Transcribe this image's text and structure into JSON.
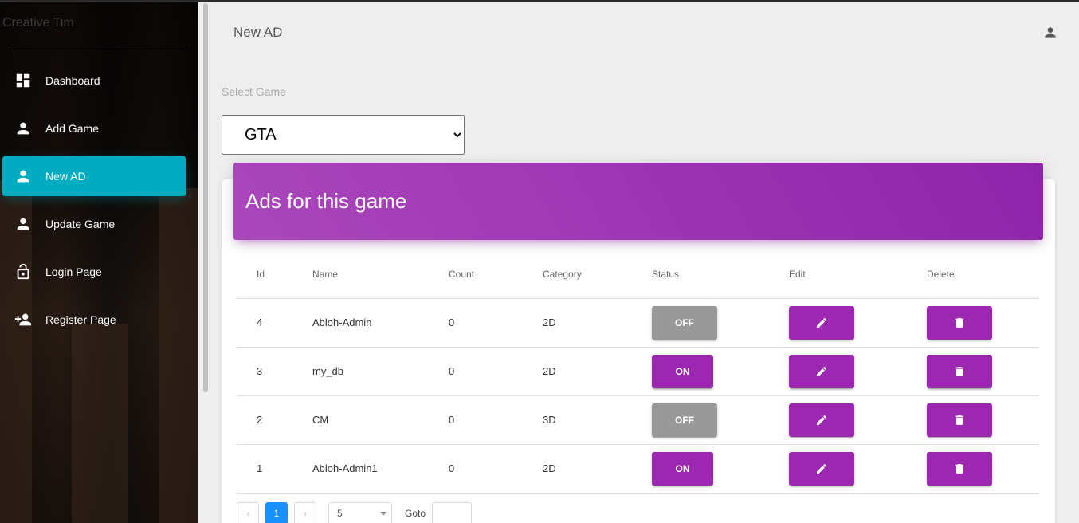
{
  "sidebar": {
    "brand": "Creative Tim",
    "items": [
      {
        "label": "Dashboard",
        "icon": "dashboard-icon"
      },
      {
        "label": "Add Game",
        "icon": "person-icon"
      },
      {
        "label": "New AD",
        "icon": "person-icon",
        "active": true
      },
      {
        "label": "Update Game",
        "icon": "person-icon"
      },
      {
        "label": "Login Page",
        "icon": "lock-icon"
      },
      {
        "label": "Register Page",
        "icon": "person-add-icon"
      }
    ]
  },
  "header": {
    "title": "New AD",
    "user_icon": "person-icon"
  },
  "game_select": {
    "label": "Select Game",
    "value": "GTA"
  },
  "card": {
    "title": "Ads for this game",
    "columns": [
      "Id",
      "Name",
      "Count",
      "Category",
      "Status",
      "Edit",
      "Delete"
    ],
    "rows": [
      {
        "id": "4",
        "name": "Abloh-Admin",
        "count": "0",
        "category": "2D",
        "status": "OFF"
      },
      {
        "id": "3",
        "name": "my_db",
        "count": "0",
        "category": "2D",
        "status": "ON"
      },
      {
        "id": "2",
        "name": "CM",
        "count": "0",
        "category": "3D",
        "status": "OFF"
      },
      {
        "id": "1",
        "name": "Abloh-Admin1",
        "count": "0",
        "category": "2D",
        "status": "ON"
      }
    ]
  },
  "pagination": {
    "prev": "‹",
    "current": "1",
    "next": "›",
    "page_size": "5",
    "goto_label": "Goto"
  },
  "colors": {
    "accent": "#9c27b0",
    "active_nav": "#00acc1",
    "status_off": "#999999",
    "page_current": "#1890ff"
  }
}
